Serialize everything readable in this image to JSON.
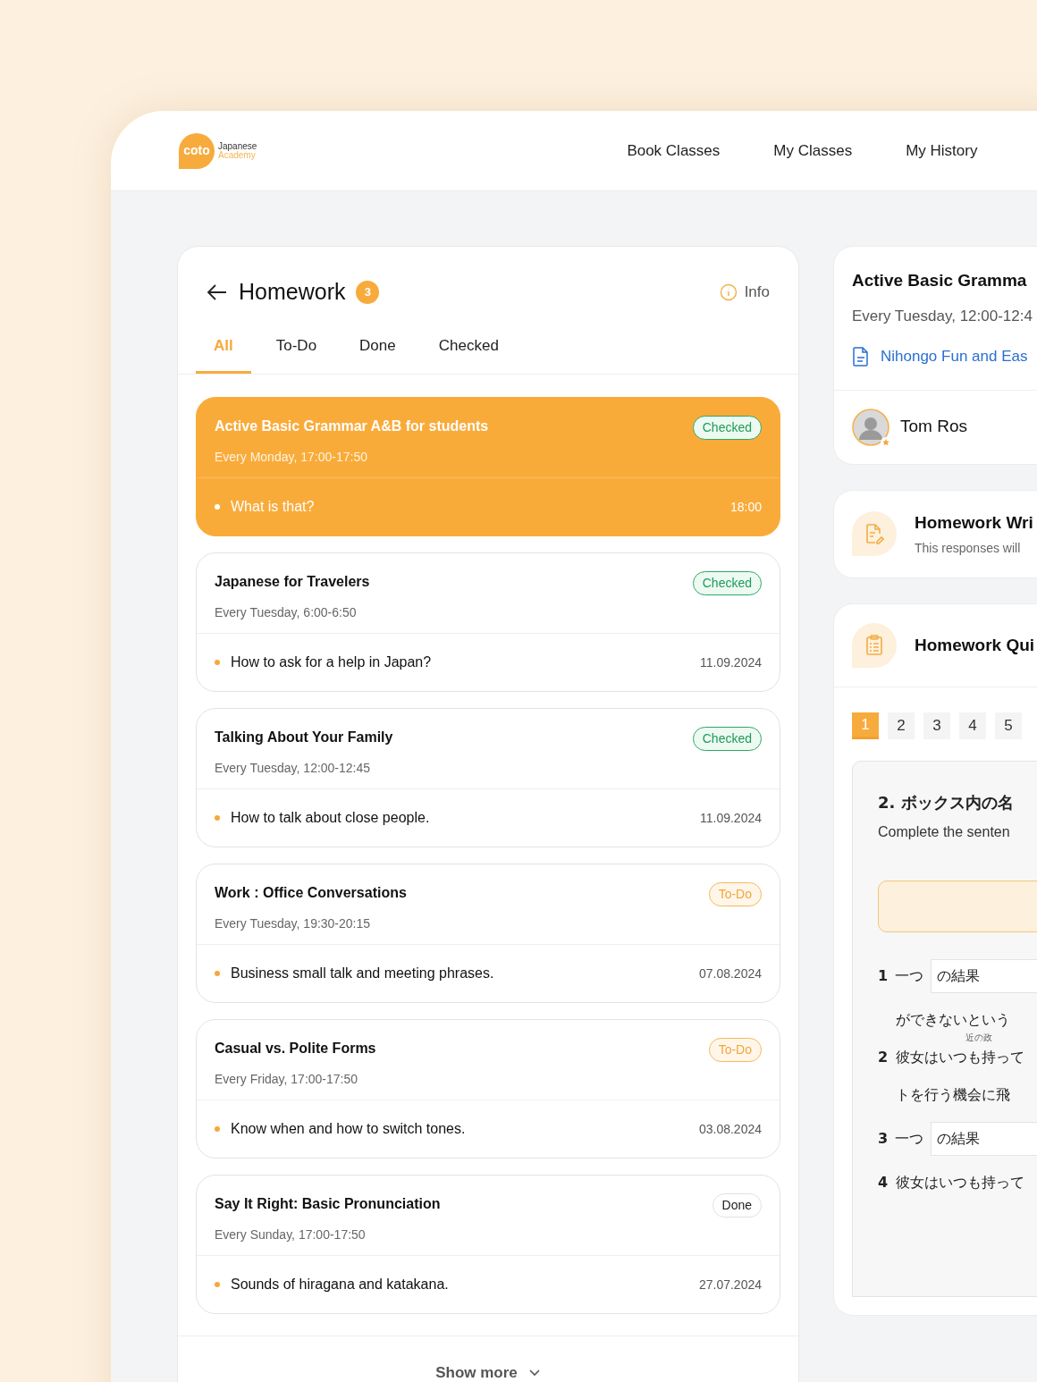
{
  "brand": {
    "logo": "coto",
    "name": "Japanese",
    "subtitle": "Academy"
  },
  "nav": [
    "Book Classes",
    "My Classes",
    "My History"
  ],
  "homework": {
    "title": "Homework",
    "count": "3",
    "info": "Info",
    "tabs": [
      {
        "label": "All",
        "selected": true
      },
      {
        "label": "To-Do",
        "selected": false
      },
      {
        "label": "Done",
        "selected": false
      },
      {
        "label": "Checked",
        "selected": false
      }
    ],
    "cards": [
      {
        "title": "Active Basic Grammar A&B for students",
        "schedule": "Every Monday, 17:00-17:50",
        "status": {
          "kind": "checked",
          "label": "Checked"
        },
        "topic": "What is that?",
        "date": "18:00",
        "selected": true
      },
      {
        "title": "Japanese for Travelers",
        "schedule": "Every Tuesday, 6:00-6:50",
        "status": {
          "kind": "checked",
          "label": "Checked"
        },
        "topic": "How to ask for a help in Japan?",
        "date": "11.09.2024",
        "selected": false
      },
      {
        "title": "Talking About Your Family",
        "schedule": "Every Tuesday, 12:00-12:45",
        "status": {
          "kind": "checked",
          "label": "Checked"
        },
        "topic": "How to talk about close people.",
        "date": "11.09.2024",
        "selected": false
      },
      {
        "title": "Work : Office Conversations",
        "schedule": "Every Tuesday, 19:30-20:15",
        "status": {
          "kind": "todo",
          "label": "To-Do"
        },
        "topic": "Business small talk and meeting phrases.",
        "date": "07.08.2024",
        "selected": false
      },
      {
        "title": "Casual vs. Polite Forms",
        "schedule": "Every Friday, 17:00-17:50",
        "status": {
          "kind": "todo",
          "label": "To-Do"
        },
        "topic": "Know when and how to switch tones.",
        "date": "03.08.2024",
        "selected": false
      },
      {
        "title": "Say It Right: Basic Pronunciation",
        "schedule": "Every Sunday, 17:00-17:50",
        "status": {
          "kind": "done",
          "label": "Done"
        },
        "topic": "Sounds of hiragana and katakana.",
        "date": "27.07.2024",
        "selected": false
      }
    ],
    "show_more": "Show more"
  },
  "class_info": {
    "title": "Active Basic Gramma",
    "schedule": "Every Tuesday, 12:00-12:4",
    "material": "Nihongo Fun and Eas",
    "teacher": "Tom Ros"
  },
  "written": {
    "title": "Homework Wri",
    "subtitle": "This responses will"
  },
  "quiz": {
    "title": "Homework Qui",
    "pages": [
      {
        "label": "1",
        "selected": true
      },
      {
        "label": "2",
        "selected": false
      },
      {
        "label": "3",
        "selected": false
      },
      {
        "label": "4",
        "selected": false
      },
      {
        "label": "5",
        "selected": false
      }
    ],
    "question": {
      "heading": "2. ボックス内の名",
      "instruction": "Complete the senten",
      "items": [
        {
          "number": "1",
          "kind": "input",
          "prefix": "一つ",
          "value": "の結果",
          "continuation": "ができないという"
        },
        {
          "number": "2",
          "kind": "text",
          "ruby": "近の政",
          "text": "彼女はいつも持って",
          "continuation": "トを行う機会に飛"
        },
        {
          "number": "3",
          "kind": "input",
          "prefix": "一つ",
          "value": "の結果"
        },
        {
          "number": "4",
          "kind": "text",
          "text": "彼女はいつも持って"
        }
      ]
    }
  }
}
